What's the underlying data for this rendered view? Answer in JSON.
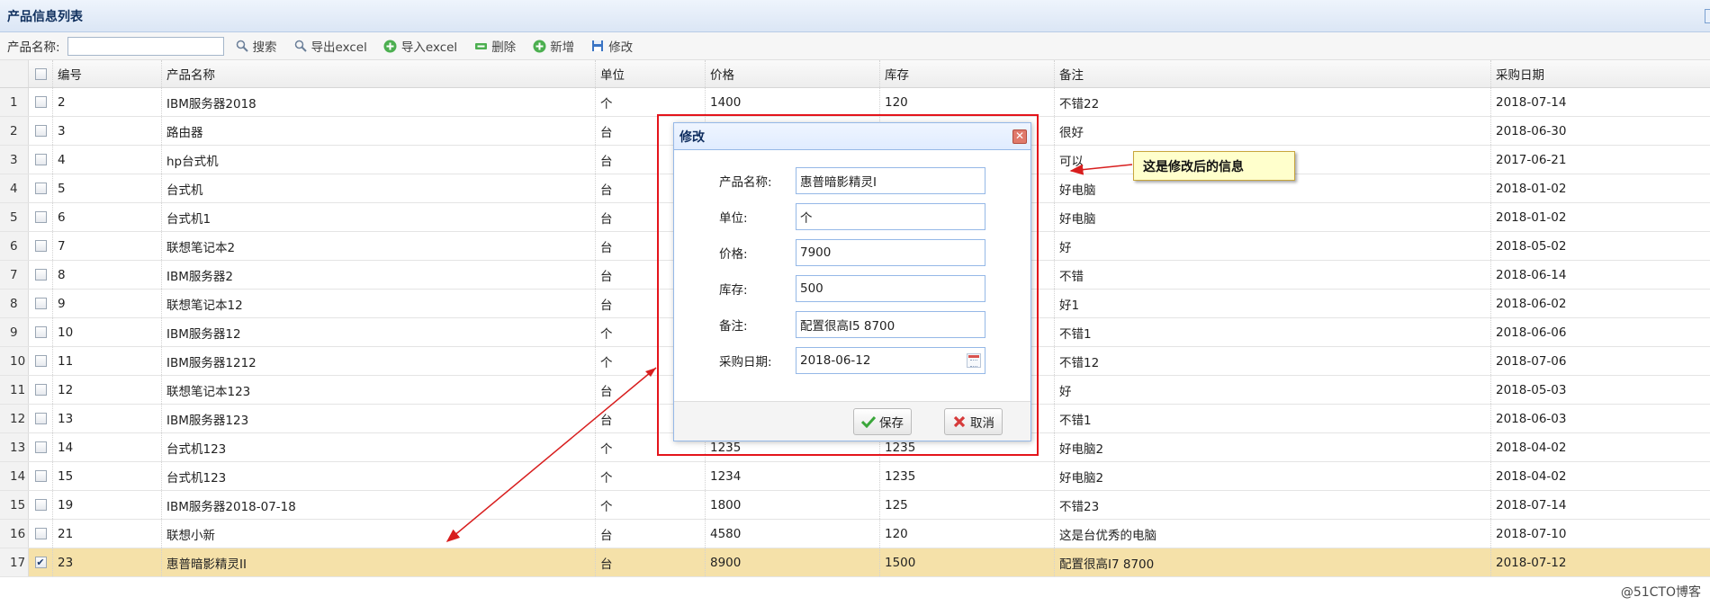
{
  "panel": {
    "title": "产品信息列表"
  },
  "toolbar": {
    "name_label": "产品名称:",
    "name_value": "",
    "buttons": [
      {
        "label": "搜索",
        "icon": "search-icon"
      },
      {
        "label": "导出excel",
        "icon": "search-icon"
      },
      {
        "label": "导入excel",
        "icon": "add-icon"
      },
      {
        "label": "删除",
        "icon": "remove-icon"
      },
      {
        "label": "新增",
        "icon": "add-icon"
      },
      {
        "label": "修改",
        "icon": "save-icon"
      }
    ]
  },
  "table": {
    "columns": [
      "编号",
      "产品名称",
      "单位",
      "价格",
      "库存",
      "备注",
      "采购日期"
    ],
    "rows": [
      {
        "n": "1",
        "id": "2",
        "name": "IBM服务器2018",
        "unit": "个",
        "price": "1400",
        "stock": "120",
        "remark": "不错22",
        "date": "2018-07-14",
        "checked": false
      },
      {
        "n": "2",
        "id": "3",
        "name": "路由器",
        "unit": "台",
        "price": "",
        "stock": "",
        "remark": "很好",
        "date": "2018-06-30",
        "checked": false
      },
      {
        "n": "3",
        "id": "4",
        "name": "hp台式机",
        "unit": "台",
        "price": "",
        "stock": "",
        "remark": "可以",
        "date": "2017-06-21",
        "checked": false
      },
      {
        "n": "4",
        "id": "5",
        "name": "台式机",
        "unit": "台",
        "price": "",
        "stock": "",
        "remark": "好电脑",
        "date": "2018-01-02",
        "checked": false
      },
      {
        "n": "5",
        "id": "6",
        "name": "台式机1",
        "unit": "台",
        "price": "",
        "stock": "",
        "remark": "好电脑",
        "date": "2018-01-02",
        "checked": false
      },
      {
        "n": "6",
        "id": "7",
        "name": "联想笔记本2",
        "unit": "台",
        "price": "",
        "stock": "",
        "remark": "好",
        "date": "2018-05-02",
        "checked": false
      },
      {
        "n": "7",
        "id": "8",
        "name": "IBM服务器2",
        "unit": "台",
        "price": "",
        "stock": "",
        "remark": "不错",
        "date": "2018-06-14",
        "checked": false
      },
      {
        "n": "8",
        "id": "9",
        "name": "联想笔记本12",
        "unit": "台",
        "price": "",
        "stock": "",
        "remark": "好1",
        "date": "2018-06-02",
        "checked": false
      },
      {
        "n": "9",
        "id": "10",
        "name": "IBM服务器12",
        "unit": "个",
        "price": "",
        "stock": "",
        "remark": "不错1",
        "date": "2018-06-06",
        "checked": false
      },
      {
        "n": "10",
        "id": "11",
        "name": "IBM服务器1212",
        "unit": "个",
        "price": "",
        "stock": "",
        "remark": "不错12",
        "date": "2018-07-06",
        "checked": false
      },
      {
        "n": "11",
        "id": "12",
        "name": "联想笔记本123",
        "unit": "台",
        "price": "",
        "stock": "",
        "remark": "好",
        "date": "2018-05-03",
        "checked": false
      },
      {
        "n": "12",
        "id": "13",
        "name": "IBM服务器123",
        "unit": "台",
        "price": "",
        "stock": "",
        "remark": "不错1",
        "date": "2018-06-03",
        "checked": false
      },
      {
        "n": "13",
        "id": "14",
        "name": "台式机123",
        "unit": "个",
        "price": "1235",
        "stock": "1235",
        "remark": "好电脑2",
        "date": "2018-04-02",
        "checked": false
      },
      {
        "n": "14",
        "id": "15",
        "name": "台式机123",
        "unit": "个",
        "price": "1234",
        "stock": "1235",
        "remark": "好电脑2",
        "date": "2018-04-02",
        "checked": false
      },
      {
        "n": "15",
        "id": "19",
        "name": "IBM服务器2018-07-18",
        "unit": "个",
        "price": "1800",
        "stock": "125",
        "remark": "不错23",
        "date": "2018-07-14",
        "checked": false
      },
      {
        "n": "16",
        "id": "21",
        "name": "联想小新",
        "unit": "台",
        "price": "4580",
        "stock": "120",
        "remark": "这是台优秀的电脑",
        "date": "2018-07-10",
        "checked": false
      },
      {
        "n": "17",
        "id": "23",
        "name": "惠普暗影精灵II",
        "unit": "台",
        "price": "8900",
        "stock": "1500",
        "remark": "配置很高I7 8700",
        "date": "2018-07-12",
        "checked": true
      }
    ]
  },
  "dialog": {
    "title": "修改",
    "close_glyph": "✕",
    "fields": [
      {
        "label": "产品名称:",
        "value": "惠普暗影精灵I"
      },
      {
        "label": "单位:",
        "value": "个"
      },
      {
        "label": "价格:",
        "value": "7900"
      },
      {
        "label": "库存:",
        "value": "500"
      },
      {
        "label": "备注:",
        "value": "配置很高I5 8700"
      },
      {
        "label": "采购日期:",
        "value": "2018-06-12"
      }
    ],
    "save_label": "保存",
    "cancel_label": "取消"
  },
  "annotation": {
    "callout": "这是修改后的信息",
    "color": "#d81e1e"
  },
  "watermark": "@51CTO博客",
  "colors": {
    "selected_row": "#f5e1a9",
    "header_bg": "#dbe6f5",
    "accent_border": "#95b8e7",
    "red_frame": "#e4141b"
  }
}
